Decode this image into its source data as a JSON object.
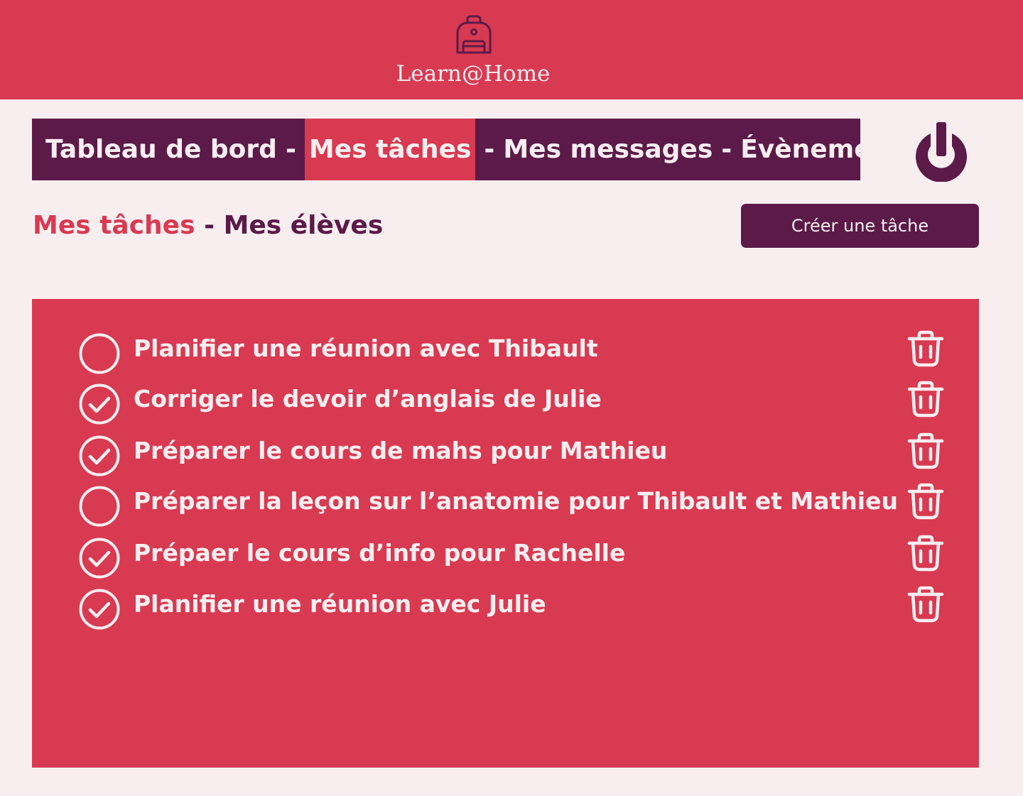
{
  "header": {
    "logo_icon": "backpack-icon",
    "brand": "Learn@Home"
  },
  "nav": {
    "items": [
      {
        "label": "Tableau de bord",
        "active": false
      },
      {
        "label": "Mes tâches",
        "active": true
      },
      {
        "label": "Mes messages",
        "active": false
      },
      {
        "label": "Évènements",
        "active": false
      }
    ],
    "separator": "-",
    "logout_icon": "power-icon"
  },
  "subnav": {
    "active": "Mes tâches",
    "separator": "-",
    "other": "Mes élèves"
  },
  "toolbar": {
    "create_label": "Créer une tâche"
  },
  "tasks": [
    {
      "label": "Planifier une réunion avec Thibault",
      "done": false
    },
    {
      "label": "Corriger le devoir d’anglais de Julie",
      "done": true
    },
    {
      "label": "Préparer le cours de mahs pour Mathieu",
      "done": true
    },
    {
      "label": "Préparer la leçon sur l’anatomie pour Thibault et Mathieu",
      "done": false
    },
    {
      "label": "Prépaer le cours d’info pour Rachelle",
      "done": true
    },
    {
      "label": "Planifier une réunion avec Julie",
      "done": true
    }
  ],
  "colors": {
    "primary": "#d83a51",
    "dark": "#5b1a48",
    "background": "#f8eef0"
  }
}
